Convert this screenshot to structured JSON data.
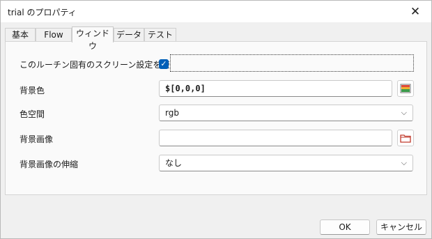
{
  "window": {
    "title": "trial のプロパティ"
  },
  "tabs": [
    {
      "label": "基本"
    },
    {
      "label": "Flow"
    },
    {
      "label": "ウィンドウ"
    },
    {
      "label": "データ"
    },
    {
      "label": "テスト"
    }
  ],
  "active_tab": "ウィンドウ",
  "form": {
    "use_specific_label": "このルーチン固有のスクリーン設定を使用",
    "use_specific_checked": true,
    "bg_color_label": "背景色",
    "bg_color_value": "$[0,0,0]",
    "color_space_label": "色空間",
    "color_space_value": "rgb",
    "bg_image_label": "背景画像",
    "bg_image_value": "",
    "bg_image_stretch_label": "背景画像の伸縮",
    "bg_image_stretch_value": "なし"
  },
  "buttons": {
    "ok": "OK",
    "cancel": "キャンセル"
  },
  "icons": {
    "close": "close-icon",
    "color_picker": "color-picker-icon",
    "folder": "folder-open-icon",
    "check": "checkmark-icon",
    "chevron": "chevron-down-icon"
  },
  "colors": {
    "accent": "#005fb8"
  }
}
